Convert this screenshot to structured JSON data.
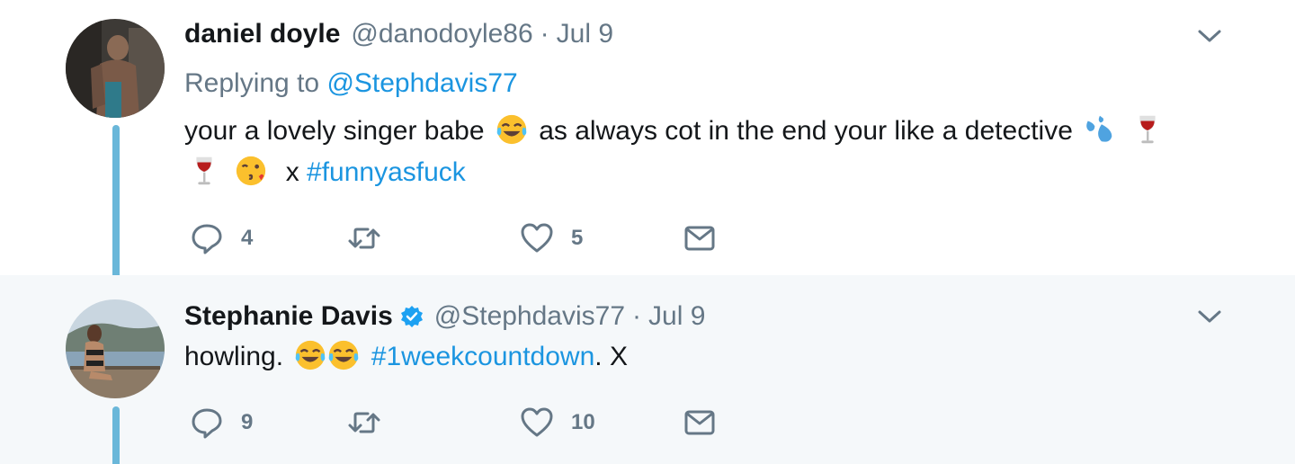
{
  "tweets": [
    {
      "name": "daniel doyle",
      "handle": "@danodoyle86",
      "separator": "·",
      "date": "Jul 9",
      "replying_prefix": "Replying to",
      "replying_to": "@Stephdavis77",
      "text_1": "your a lovely singer babe",
      "text_2": "as always cot in the end your like a detective",
      "text_3": "x",
      "hashtag": "#funnyasfuck",
      "reply_count": "4",
      "retweet_count": "",
      "like_count": "5",
      "verified": false
    },
    {
      "name": "Stephanie Davis",
      "handle": "@Stephdavis77",
      "separator": "·",
      "date": "Jul 9",
      "text_1": "howling.",
      "hashtag": "#1weekcountdown",
      "text_2": ". X",
      "reply_count": "9",
      "retweet_count": "",
      "like_count": "10",
      "verified": true
    }
  ],
  "colors": {
    "link": "#1b95e0",
    "muted": "#657786",
    "thread_line": "#6ab7d9",
    "highlight_bg": "#f5f8fa"
  },
  "icons": [
    "reply-icon",
    "retweet-icon",
    "like-icon",
    "direct-message-icon",
    "caret-down-icon",
    "verified-badge-icon"
  ]
}
